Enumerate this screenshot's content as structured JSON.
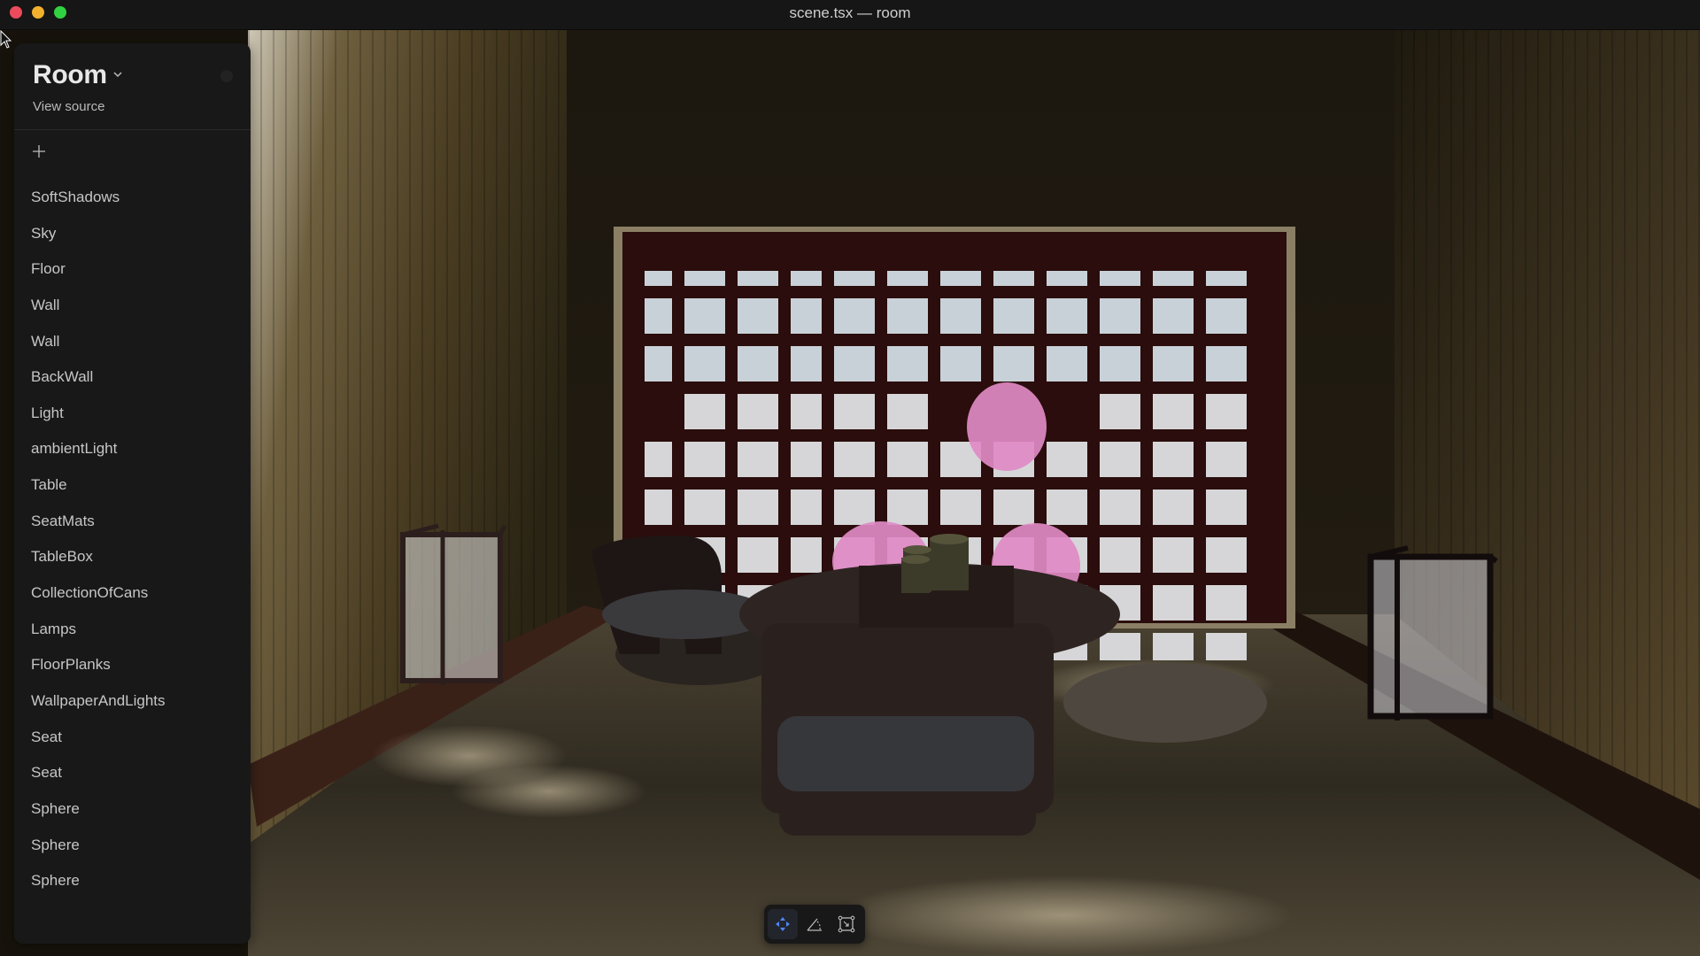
{
  "window": {
    "title": "scene.tsx — room",
    "traffic_lights": {
      "close": "#ec4b5b",
      "minimize": "#f1b12d",
      "maximize": "#31d241"
    }
  },
  "sidebar": {
    "title": "Room",
    "title_icon": "chevron-down-icon",
    "view_source_label": "View source",
    "add_icon": "plus-icon",
    "status_dot_icon": "status-dot-icon",
    "items": [
      {
        "label": "SoftShadows"
      },
      {
        "label": "Sky"
      },
      {
        "label": "Floor"
      },
      {
        "label": "Wall"
      },
      {
        "label": "Wall"
      },
      {
        "label": "BackWall"
      },
      {
        "label": "Light"
      },
      {
        "label": "ambientLight"
      },
      {
        "label": "Table"
      },
      {
        "label": "SeatMats"
      },
      {
        "label": "TableBox"
      },
      {
        "label": "CollectionOfCans"
      },
      {
        "label": "Lamps"
      },
      {
        "label": "FloorPlanks"
      },
      {
        "label": "WallpaperAndLights"
      },
      {
        "label": "Seat"
      },
      {
        "label": "Seat"
      },
      {
        "label": "Sphere"
      },
      {
        "label": "Sphere"
      },
      {
        "label": "Sphere"
      }
    ]
  },
  "toolbar": {
    "tools": [
      {
        "name": "translate",
        "icon": "move-arrows-icon",
        "active": true
      },
      {
        "name": "rotate",
        "icon": "rotate-angle-icon",
        "active": false
      },
      {
        "name": "scale",
        "icon": "scale-box-icon",
        "active": false
      }
    ],
    "active_color": "#4f86f7"
  },
  "scene": {
    "description": "3D rendered Japanese-style room with shoji window, round table, seats, and two paper lanterns",
    "sphere_color": "#e08ac6"
  }
}
